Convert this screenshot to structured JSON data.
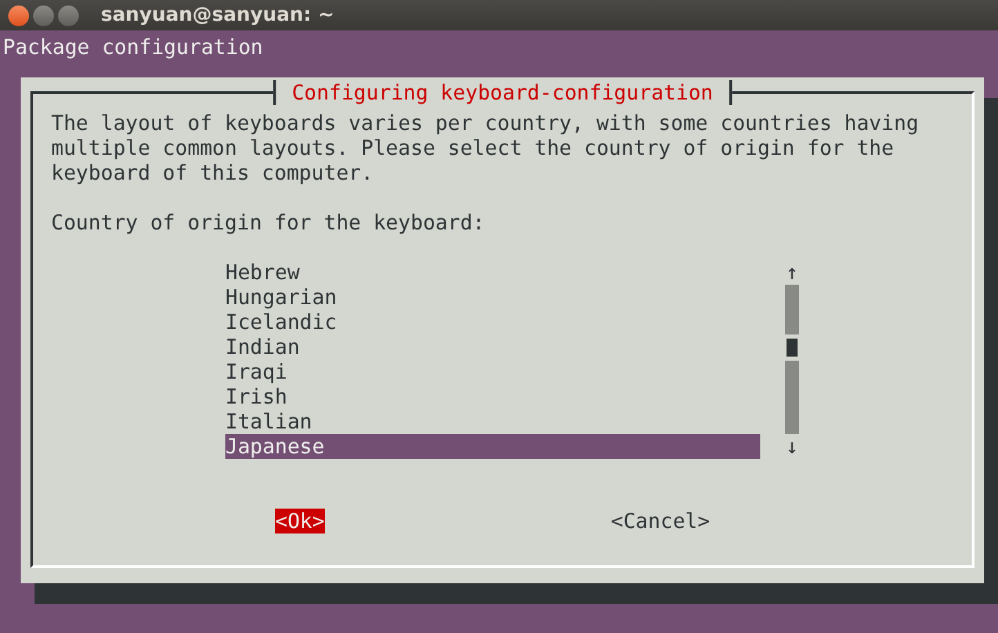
{
  "window": {
    "title": "sanyuan@sanyuan: ~"
  },
  "header": "Package configuration",
  "dialog": {
    "title": "Configuring keyboard-configuration",
    "description": "The layout of keyboards varies per country, with some countries having multiple common layouts. Please select the country of origin for the keyboard of this computer.",
    "prompt": "Country of origin for the keyboard:",
    "items": [
      {
        "label": "Hebrew",
        "selected": false
      },
      {
        "label": "Hungarian",
        "selected": false
      },
      {
        "label": "Icelandic",
        "selected": false
      },
      {
        "label": "Indian",
        "selected": false
      },
      {
        "label": "Iraqi",
        "selected": false
      },
      {
        "label": "Irish",
        "selected": false
      },
      {
        "label": "Italian",
        "selected": false
      },
      {
        "label": "Japanese",
        "selected": true
      }
    ],
    "scroll_up": "↑",
    "scroll_down": "↓",
    "buttons": [
      {
        "label": "<Ok>",
        "selected": true
      },
      {
        "label": "<Cancel>",
        "selected": false
      }
    ]
  }
}
